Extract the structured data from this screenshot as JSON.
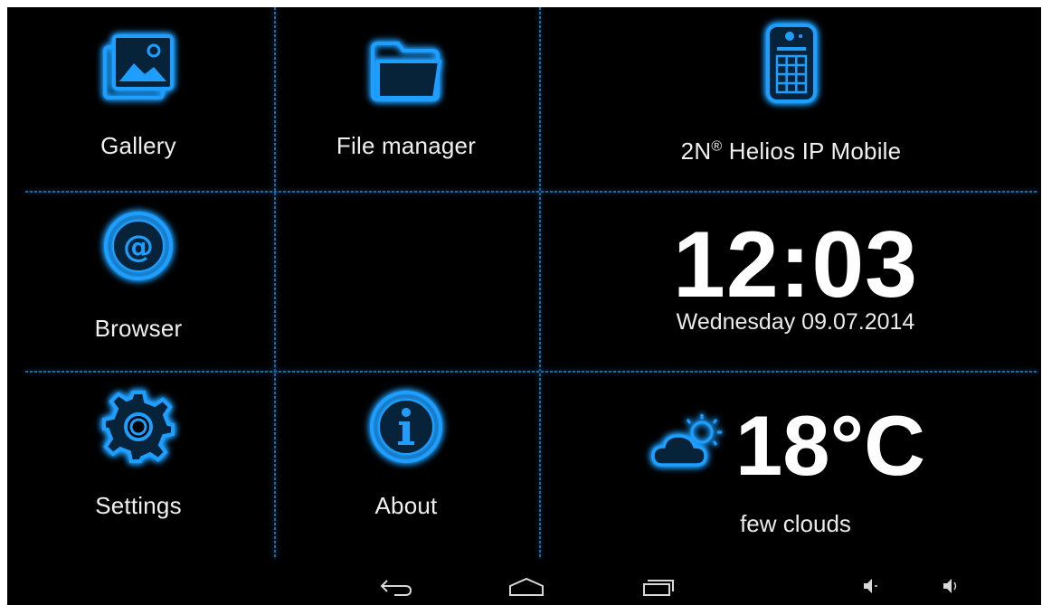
{
  "tiles": {
    "gallery": {
      "label": "Gallery",
      "icon": "gallery-icon"
    },
    "file_manager": {
      "label": "File manager",
      "icon": "folder-icon"
    },
    "helios": {
      "label_main": "2N",
      "label_sup": "®",
      "label_rest": " Helios IP Mobile",
      "icon": "intercom-icon"
    },
    "browser": {
      "label": "Browser",
      "icon": "at-sign-icon"
    },
    "settings": {
      "label": "Settings",
      "icon": "gear-icon"
    },
    "about": {
      "label": "About",
      "icon": "info-icon"
    }
  },
  "clock": {
    "time": "12:03",
    "date": "Wednesday 09.07.2014"
  },
  "weather": {
    "temperature": "18°C",
    "description": "few clouds",
    "icon": "partly-cloudy-icon"
  },
  "nav": {
    "back": "back-icon",
    "home": "home-icon",
    "recents": "recent-apps-icon",
    "volume_down": "volume-down-icon",
    "volume_up": "volume-up-icon"
  },
  "colors": {
    "accent": "#1e9fff",
    "background": "#000000",
    "text": "#f0f0f0"
  }
}
